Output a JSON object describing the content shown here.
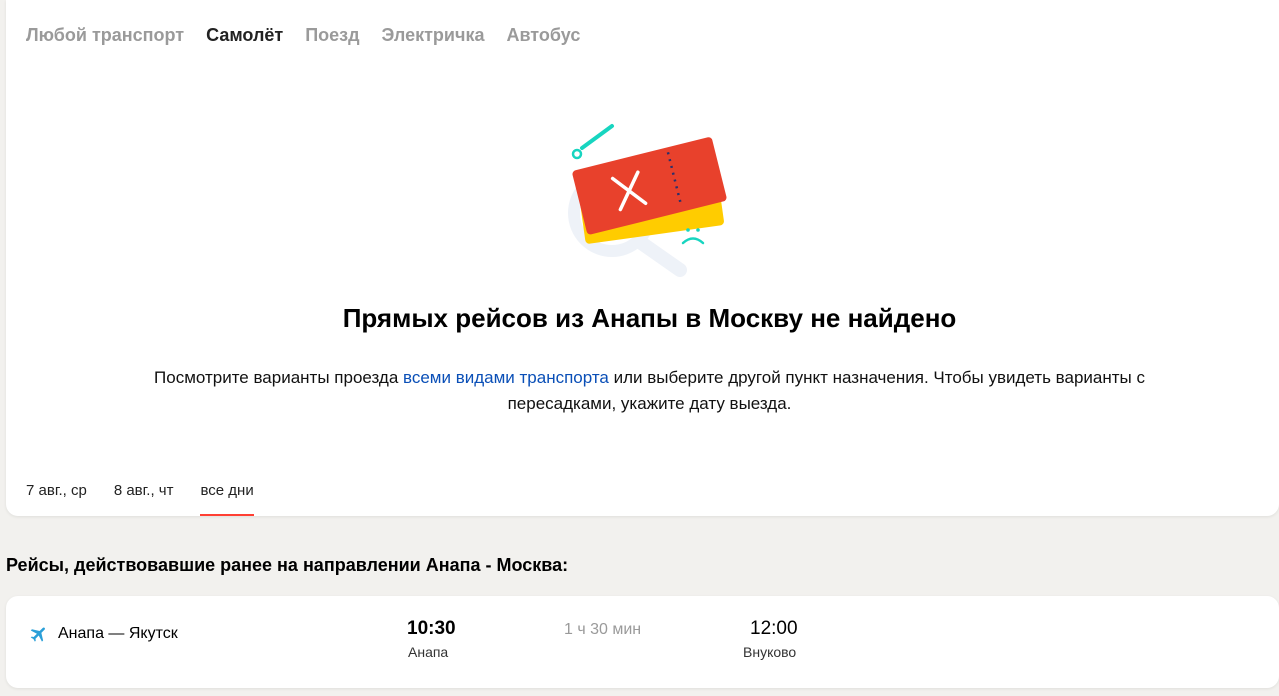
{
  "tabs": [
    {
      "label": "Любой транспорт"
    },
    {
      "label": "Самолёт"
    },
    {
      "label": "Поезд"
    },
    {
      "label": "Электричка"
    },
    {
      "label": "Автобус"
    }
  ],
  "active_tab": "Самолёт",
  "empty_state": {
    "title": "Прямых рейсов из Анапы в Москву не найдено",
    "desc_before": "Посмотрите варианты проезда ",
    "desc_link": "всеми видами транспорта",
    "desc_after": " или выберите другой пункт назначения. Чтобы увидеть варианты с пересадками, укажите дату выезда."
  },
  "dates": [
    {
      "label": "7 авг., ср"
    },
    {
      "label": "8 авг., чт"
    },
    {
      "label": "все дни"
    }
  ],
  "active_date": "все дни",
  "previous_section": {
    "title": "Рейсы, действовавшие ранее на направлении Анапа - Москва:"
  },
  "flight": {
    "icon": "plane-icon",
    "route": "Анапа — Якутск",
    "departure_time": "10:30",
    "departure_place": "Анапа",
    "duration": "1 ч 30 мин",
    "arrival_time": "12:00",
    "arrival_place": "Внуково"
  },
  "colors": {
    "page_bg": "#f2f1ee",
    "link": "#0a4fb7",
    "active_underline": "#ff3f33",
    "ticket_red": "#e8412c",
    "ticket_yellow": "#ffcc00",
    "accent_teal": "#17d5c0",
    "plane_blue": "#2a9fd8"
  }
}
